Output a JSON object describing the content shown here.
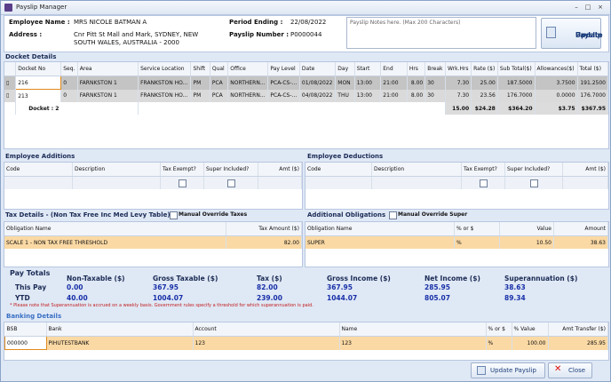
{
  "window": {
    "title": "Payslip Manager",
    "minimize": "–",
    "maximize": "□",
    "close": "×"
  },
  "header": {
    "employee_name_label": "Employee Name :",
    "employee_name": "MRS NICOLE BATMAN A",
    "address_label": "Address :",
    "address_line1": "Cnr Pitt St Mall and Mark, SYDNEY, NEW",
    "address_line2": "SOUTH WALES, AUSTRALIA - 2000",
    "period_label": "Period Ending :",
    "period_value": "22/08/2022",
    "payslip_number_label": "Payslip Number :",
    "payslip_number_value": "P0000044",
    "notes_placeholder": "Payslip Notes here. (Max 200 Characters)",
    "update_button": {
      "line1": "Update",
      "line2": "Payslip"
    }
  },
  "docket": {
    "section_title": "Docket Details",
    "columns": [
      "Docket No",
      "Seq.",
      "Area",
      "Service Location",
      "Shift",
      "Qual",
      "Office",
      "Pay Level",
      "Date",
      "Day",
      "Start",
      "End",
      "Hrs",
      "Break",
      "Wrk.Hrs",
      "Rate ($)",
      "Sub Total($)",
      "Allowances($)",
      "Total ($)"
    ],
    "rows": [
      [
        "216",
        "0",
        "FARNKSTON 1",
        "FRANKSTON HO...",
        "PM",
        "PCA",
        "NORTHERN...",
        "PCA-CS-...",
        "01/08/2022",
        "MON",
        "13:00",
        "21:00",
        "8.00",
        "30",
        "7.30",
        "25.00",
        "187.5000",
        "3.7500",
        "191.2500"
      ],
      [
        "213",
        "0",
        "FARNKSTON 1",
        "FRANKSTON HO...",
        "PM",
        "PCA",
        "NORTHERN...",
        "PCA-CS-...",
        "04/08/2022",
        "THU",
        "13:00",
        "21:00",
        "8.00",
        "30",
        "7.30",
        "23.56",
        "176.7000",
        "0.0000",
        "176.7000"
      ]
    ],
    "total_row": {
      "label": "Docket : 2",
      "wrk_hrs": "15.00",
      "rate": "$24.28",
      "sub_total": "$364.20",
      "allowances": "$3.75",
      "total": "$367.95"
    }
  },
  "additions": {
    "title": "Employee Additions",
    "columns": [
      "Code",
      "Description",
      "Tax Exempt?",
      "Super Included?",
      "Amt ($)"
    ]
  },
  "deductions": {
    "title": "Employee Deductions",
    "columns": [
      "Code",
      "Description",
      "Tax Exempt?",
      "Super Included?",
      "Amt ($)"
    ]
  },
  "tax": {
    "title": "Tax Details - (Non Tax Free Inc Med Levy Table)",
    "override_label": "Manual Override Taxes",
    "columns": [
      "Obligation Name",
      "Tax Amount ($)"
    ],
    "rows": [
      [
        "SCALE 1 - NON TAX FREE THRESHOLD",
        "82.00"
      ]
    ]
  },
  "obligations": {
    "title": "Additional Obligations",
    "override_label": "Manual Override Super",
    "columns": [
      "Obligation Name",
      "% or $",
      "Value",
      "Amount"
    ],
    "rows": [
      [
        "SUPER",
        "%",
        "10.50",
        "38.63"
      ]
    ]
  },
  "pay_totals": {
    "title": "Pay Totals",
    "row_labels": {
      "this_pay": "This Pay",
      "ytd": "YTD"
    },
    "columns": [
      {
        "label": "Non-Taxable ($)",
        "this_pay": "0.00",
        "ytd": "40.00"
      },
      {
        "label": "Gross Taxable ($)",
        "this_pay": "367.95",
        "ytd": "1004.07"
      },
      {
        "label": "Tax ($)",
        "this_pay": "82.00",
        "ytd": "239.00"
      },
      {
        "label": "Gross Income ($)",
        "this_pay": "367.95",
        "ytd": "1044.07"
      },
      {
        "label": "Net Income ($)",
        "this_pay": "285.95",
        "ytd": "805.07"
      },
      {
        "label": "Superannuation ($)",
        "this_pay": "38.63",
        "ytd": "89.34"
      }
    ],
    "note": "* Please note that Superannuation is accrued on a weekly basis. Government rules specify a threshold for which superannuation is paid."
  },
  "banking": {
    "title": "Banking Details",
    "columns": [
      "BSB",
      "Bank",
      "Account",
      "Name",
      "% or $",
      "% Value",
      "Amt Transfer ($)"
    ],
    "rows": [
      [
        "000000",
        "PIHUTESTBANK",
        "123",
        "123",
        "%",
        "100.00",
        "285.95"
      ]
    ]
  },
  "footer": {
    "update_label": "Update Payslip",
    "close_label": "Close"
  }
}
